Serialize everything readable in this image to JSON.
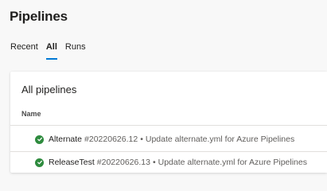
{
  "header": {
    "title": "Pipelines"
  },
  "tabs": [
    {
      "label": "Recent",
      "active": false
    },
    {
      "label": "All",
      "active": true
    },
    {
      "label": "Runs",
      "active": false
    }
  ],
  "card": {
    "title": "All pipelines",
    "column_header": "Name",
    "rows": [
      {
        "name": "Alternate",
        "run": "#20220626.12",
        "separator": "•",
        "message": "Update alternate.yml for Azure Pipelines",
        "status": "succeeded",
        "status_icon": "check-circle-icon"
      },
      {
        "name": "ReleaseTest",
        "run": "#20220626.13",
        "separator": "•",
        "message": "Update alternate.yml for Azure Pipelines",
        "status": "succeeded",
        "status_icon": "check-circle-icon"
      }
    ]
  },
  "colors": {
    "accent": "#0078d4",
    "success": "#2e8b3e"
  }
}
